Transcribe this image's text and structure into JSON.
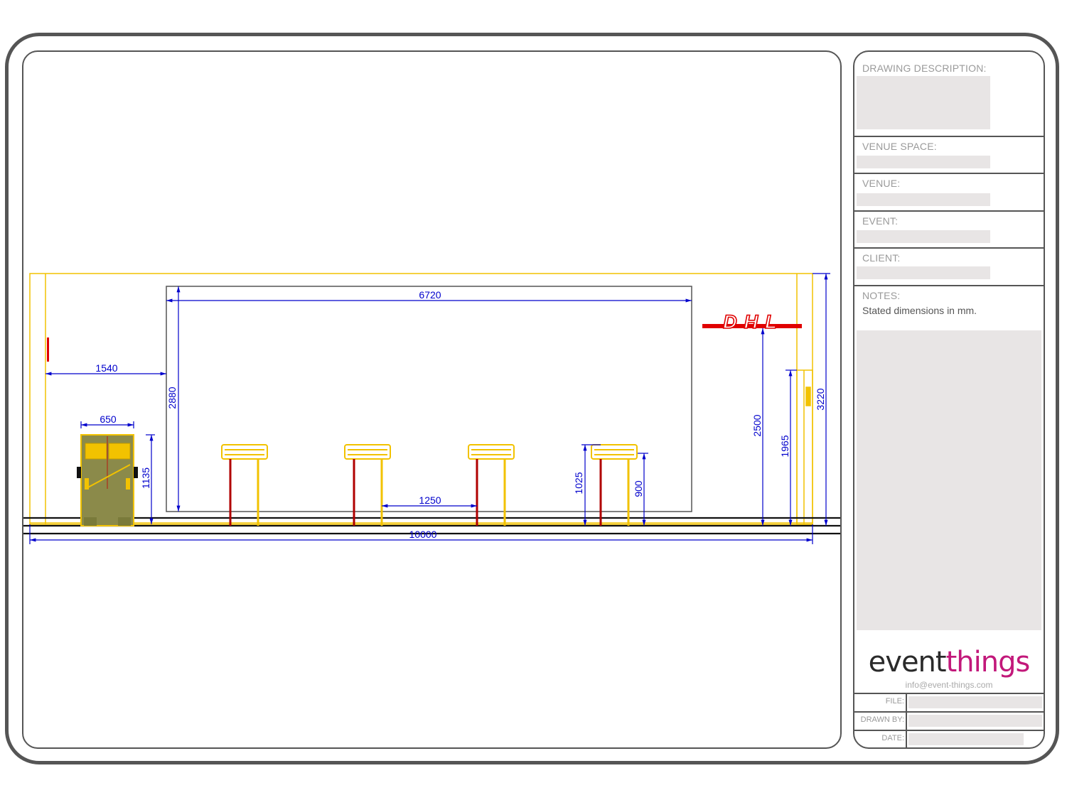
{
  "title_block": {
    "drawing_description_label": "DRAWING DESCRIPTION:",
    "venue_space_label": "VENUE SPACE:",
    "venue_label": "VENUE:",
    "event_label": "EVENT:",
    "client_label": "CLIENT:",
    "notes_label": "NOTES:",
    "notes_text": "Stated dimensions in mm.",
    "logo_part1": "event",
    "logo_part2": "things",
    "email": "info@event-things.com",
    "file_label": "FILE:",
    "drawn_by_label": "DRAWN BY:",
    "date_label": "DATE:"
  },
  "drawing": {
    "logo_text": "DHL",
    "dimensions": {
      "screen_width": "6720",
      "offset_left": "1540",
      "counter_width": "650",
      "counter_height": "1135",
      "screen_height": "2880",
      "stool_spacing": "1250",
      "stool_height": "1025",
      "seat_height": "900",
      "logo_height": "2500",
      "door_height": "1965",
      "wall_height": "3220",
      "total_length": "10000"
    }
  },
  "colors": {
    "frame": "#555555",
    "dimension": "#0000cc",
    "structure": "#f2c200",
    "brand_red": "#e00000",
    "field_fill": "#e8e5e5"
  }
}
